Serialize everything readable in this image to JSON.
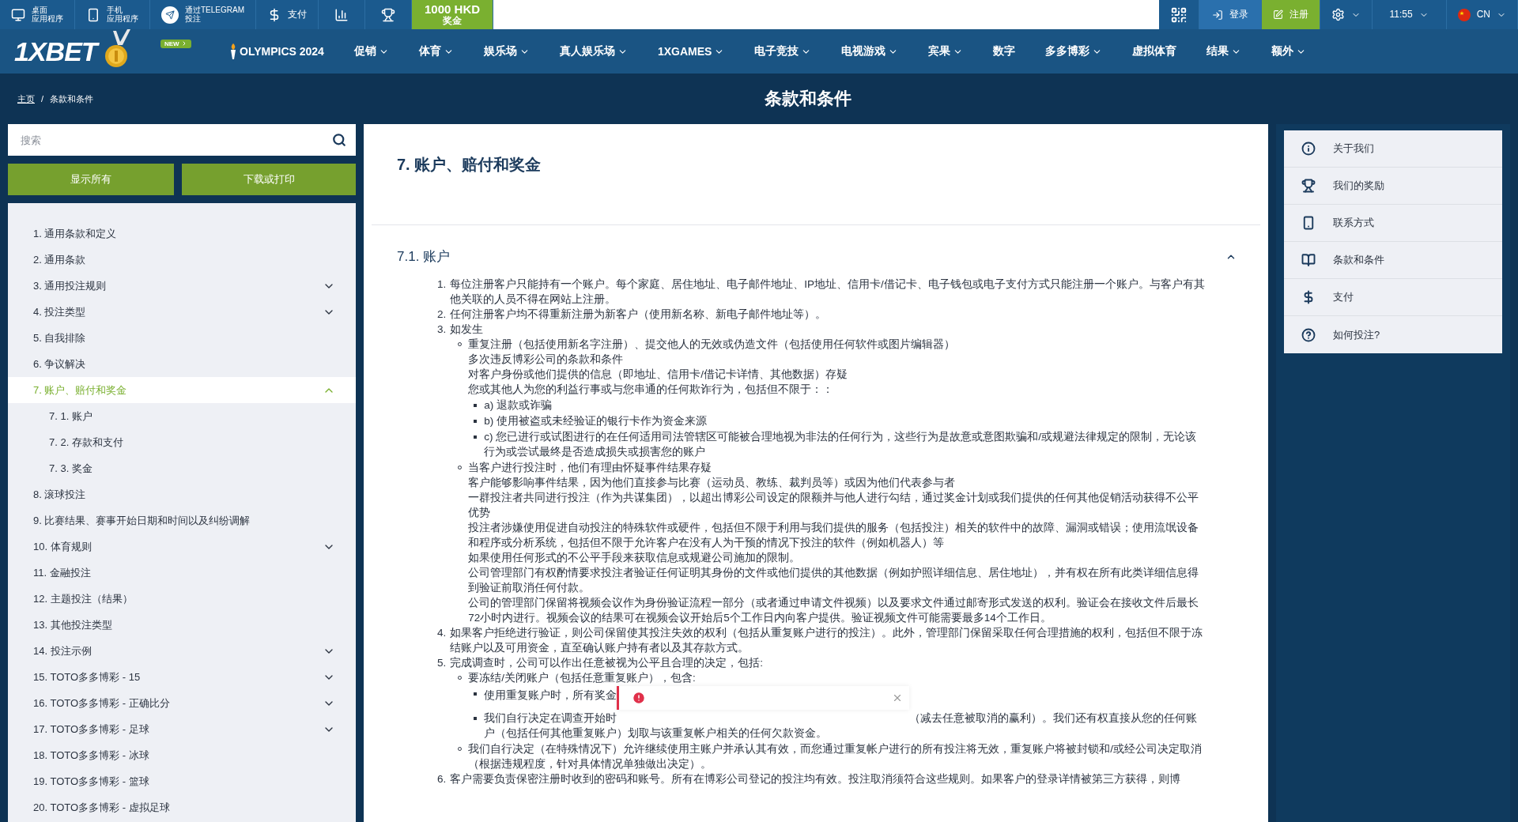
{
  "top_bar": {
    "left": [
      {
        "kind": "desktop",
        "lines": [
          "桌面",
          "应用程序"
        ]
      },
      {
        "kind": "mobile",
        "lines": [
          "手机",
          "应用程序"
        ]
      },
      {
        "kind": "telegram",
        "lines": [
          "通过TELEGRAM",
          "投注"
        ]
      },
      {
        "kind": "dollar",
        "lines": [
          "支付"
        ]
      },
      {
        "kind": "chart"
      },
      {
        "kind": "trophy"
      },
      {
        "kind": "bonus",
        "lines": [
          "1000 HKD",
          "奖金"
        ]
      }
    ],
    "right": [
      {
        "kind": "qr"
      },
      {
        "kind": "login",
        "label": "登录"
      },
      {
        "kind": "register",
        "label": "注册"
      },
      {
        "kind": "settings"
      },
      {
        "kind": "time",
        "label": "11:55"
      },
      {
        "kind": "language",
        "label": "CN"
      }
    ]
  },
  "nav": {
    "logo": "1XBET",
    "badge": "NEW",
    "items": [
      {
        "label": "OLYMPICS 2024",
        "kind": "torch",
        "dropdown": false
      },
      {
        "label": "促销",
        "dropdown": true
      },
      {
        "label": "体育",
        "dropdown": true
      },
      {
        "label": "娱乐场",
        "dropdown": true
      },
      {
        "label": "真人娱乐场",
        "dropdown": true
      },
      {
        "label": "1XGAMES",
        "dropdown": true
      },
      {
        "label": "电子竞技",
        "dropdown": true
      },
      {
        "label": "电视游戏",
        "dropdown": true
      },
      {
        "label": "宾果",
        "dropdown": true
      },
      {
        "label": "数字",
        "dropdown": false
      },
      {
        "label": "多多博彩",
        "dropdown": true
      },
      {
        "label": "虚拟体育",
        "dropdown": false
      },
      {
        "label": "结果",
        "dropdown": true
      },
      {
        "label": "额外",
        "dropdown": true
      }
    ]
  },
  "breadcrumb_separator": "/",
  "breadcrumbs": [
    {
      "label": "主页",
      "link": true
    },
    {
      "label": "条款和条件",
      "link": false
    }
  ],
  "page_title": "条款和条件",
  "search": {
    "placeholder": "搜索"
  },
  "buttons": [
    "显示所有",
    "下载或打印"
  ],
  "toc": [
    {
      "number": "1.",
      "label": "通用条款和定义",
      "expandable": false,
      "selected": false
    },
    {
      "number": "2.",
      "label": "通用条款",
      "expandable": false,
      "selected": false
    },
    {
      "number": "3.",
      "label": "通用投注规则",
      "expandable": true,
      "expanded": false,
      "selected": false
    },
    {
      "number": "4.",
      "label": "投注类型",
      "expandable": true,
      "expanded": false,
      "selected": false
    },
    {
      "number": "5.",
      "label": "自我排除",
      "expandable": false,
      "selected": false
    },
    {
      "number": "6.",
      "label": "争议解决",
      "expandable": false,
      "selected": false
    },
    {
      "number": "7.",
      "label": "账户、赔付和奖金",
      "expandable": true,
      "expanded": true,
      "selected": true,
      "children": [
        {
          "number": "7. 1.",
          "label": "账户"
        },
        {
          "number": "7. 2.",
          "label": "存款和支付"
        },
        {
          "number": "7. 3.",
          "label": "奖金"
        }
      ]
    },
    {
      "number": "8.",
      "label": "滚球投注",
      "expandable": false,
      "selected": false
    },
    {
      "number": "9.",
      "label": "比赛结果、赛事开始日期和时间以及纠纷调解",
      "expandable": false,
      "selected": false
    },
    {
      "number": "10.",
      "label": "体育规则",
      "expandable": true,
      "expanded": false,
      "selected": false
    },
    {
      "number": "11.",
      "label": "金融投注",
      "expandable": false,
      "selected": false
    },
    {
      "number": "12.",
      "label": "主题投注（结果）",
      "expandable": false,
      "selected": false
    },
    {
      "number": "13.",
      "label": "其他投注类型",
      "expandable": false,
      "selected": false
    },
    {
      "number": "14.",
      "label": "投注示例",
      "expandable": true,
      "expanded": false,
      "selected": false
    },
    {
      "number": "15.",
      "label": "TOTO多多博彩 - 15",
      "expandable": true,
      "expanded": false,
      "selected": false
    },
    {
      "number": "16.",
      "label": "TOTO多多博彩 - 正确比分",
      "expandable": true,
      "expanded": false,
      "selected": false
    },
    {
      "number": "17.",
      "label": "TOTO多多博彩 - 足球",
      "expandable": true,
      "expanded": false,
      "selected": false
    },
    {
      "number": "18.",
      "label": "TOTO多多博彩 - 冰球",
      "expandable": false,
      "selected": false
    },
    {
      "number": "19.",
      "label": "TOTO多多博彩 - 篮球",
      "expandable": false,
      "selected": false
    },
    {
      "number": "20.",
      "label": "TOTO多多博彩 - 虚拟足球",
      "expandable": false,
      "selected": false
    }
  ],
  "article": {
    "title": "7. 账户、赔付和奖金",
    "section": {
      "title": "7.1. 账户",
      "expanded": true
    },
    "clauses": [
      {
        "number": "1.",
        "text": "每位注册客户只能持有一个账户。每个家庭、居住地址、电子邮件地址、IP地址、信用卡/借记卡、电子钱包或电子支付方式只能注册一个账户。与客户有其他关联的人员不得在网站上注册。"
      },
      {
        "number": "2.",
        "text": "任何注册客户均不得重新注册为新客户（使用新名称、新电子邮件地址等）。"
      },
      {
        "number": "3.",
        "text": "如发生",
        "subs": [
          {
            "lines": [
              "重复注册（包括使用新名字注册）、提交他人的无效或伪造文件（包括使用任何软件或图片编辑器）",
              "多次违反博彩公司的条款和条件",
              "对客户身份或他们提供的信息（即地址、信用卡/借记卡详情、其他数据）存疑",
              "您或其他人为您的利益行事或与您串通的任何欺诈行为，包括但不限于：："
            ],
            "points": [
              {
                "text": "a) 退款或诈骗"
              },
              {
                "text": "b) 使用被盗或未经验证的银行卡作为资金来源"
              },
              {
                "text": "c) 您已进行或试图进行的在任何适用司法管辖区可能被合理地视为非法的任何行为，这些行为是故意或意图欺骗和/或规避法律规定的限制，无论该行为或尝试最终是否造成损失或损害您的账户"
              }
            ]
          },
          {
            "lines": [
              "当客户进行投注时，他们有理由怀疑事件结果存疑",
              "客户能够影响事件结果，因为他们直接参与比赛（运动员、教练、裁判员等）或因为他们代表参与者",
              "一群投注者共同进行投注（作为共谋集团），以超出博彩公司设定的限额并与他人进行勾结，通过奖金计划或我们提供的任何其他促销活动获得不公平优势",
              "投注者涉嫌使用促进自动投注的特殊软件或硬件，包括但不限于利用与我们提供的服务（包括投注）相关的软件中的故障、漏洞或错误；使用流氓设备和程序或分析系统，包括但不限于允许客户在没有人为干预的情况下投注的软件（例如机器人）等",
              "如果使用任何形式的不公平手段来获取信息或规避公司施加的限制。",
              "公司管理部门有权酌情要求投注者验证任何证明其身份的文件或他们提供的其他数据（例如护照详细信息、居住地址），并有权在所有此类详细信息得到验证前取消任何付款。",
              "公司的管理部门保留将视频会议作为身份验证流程一部分（或者通过申请文件视频）以及要求文件通过邮寄形式发送的权利。验证会在接收文件后最长72小时内进行。视频会议的结果可在视频会议开始后5个工作日内向客户提供。验证视频文件可能需要最多14个工作日。"
            ]
          }
        ]
      },
      {
        "number": "4.",
        "text": "如果客户拒绝进行验证，则公司保留使其投注失效的权利（包括从重复账户进行的投注）。此外，管理部门保留采取任何合理措施的权利，包括但不限于冻结账户以及可用资金，直至确认账户持有者以及其存款方式。"
      },
      {
        "number": "5.",
        "text": "完成调查时，公司可以作出任意被视为公平且合理的决定，包括:",
        "subs": [
          {
            "lines": [
              "要冻结/关闭账户（包括任意重复账户），包含:"
            ],
            "points": [
              {
                "text": "使用重复账户时，所有奖金",
                "toast": {
                  "kind": "error"
                }
              },
              {
                "text": "我们自行决定在调查开始时",
                "rest": "（减去任意被取消的赢利）。我们还有权直接从您的任何账户（包括任何其他重复账户）划取与该重复帐户相关的任何欠款资金。"
              }
            ]
          },
          {
            "lines": [
              "我们自行决定（在特殊情况下）允许继续使用主账户并承认其有效，而您通过重复帐户进行的所有投注将无效，重复账户将被封锁和/或经公司决定取消（根据违规程度，针对具体情况单独做出决定）。"
            ]
          }
        ]
      },
      {
        "number": "6.",
        "text": "客户需要负责保密注册时收到的密码和账号。所有在博彩公司登记的投注均有效。投注取消须符合这些规则。如果客户的登录详情被第三方获得，则博"
      }
    ]
  },
  "info_menu": [
    {
      "kind": "info",
      "label": "关于我们"
    },
    {
      "kind": "trophy",
      "label": "我们的奖励"
    },
    {
      "kind": "phone",
      "label": "联系方式"
    },
    {
      "kind": "book",
      "label": "条款和条件"
    },
    {
      "kind": "dollar",
      "label": "支付"
    },
    {
      "kind": "question",
      "label": "如何投注?"
    }
  ]
}
